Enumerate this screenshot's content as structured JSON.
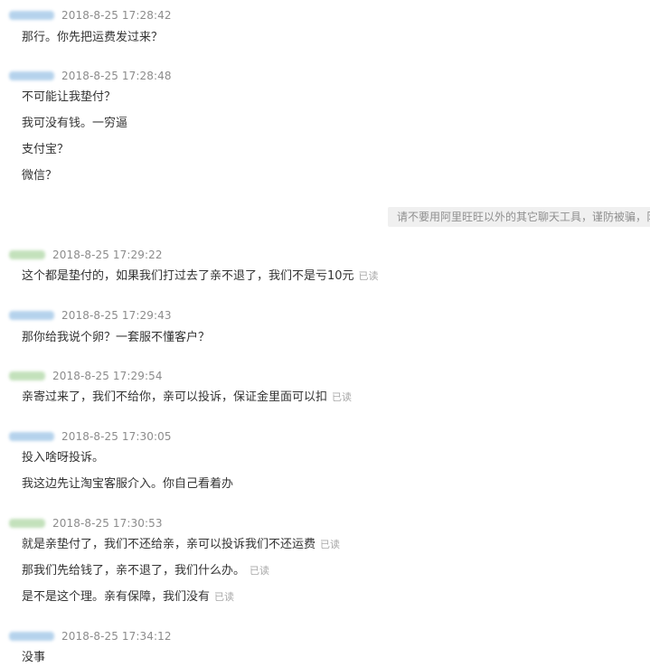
{
  "colors": {
    "customer_name_blur": "#a9cbe9",
    "seller_name_blur": "#b9dcb0",
    "timestamp": "#8c8c8c",
    "message_text": "#333333",
    "read_receipt": "#a9a9a9",
    "notice_bg": "#f0f0f0"
  },
  "notice": {
    "text": "请不要用阿里旺旺以外的其它聊天工具，谨防被骗，阝"
  },
  "groups": [
    {
      "sender": "customer",
      "time": "2018-8-25 17:28:42",
      "messages": [
        {
          "text": "那行。你先把运费发过来？",
          "read": ""
        }
      ]
    },
    {
      "sender": "customer",
      "time": "2018-8-25 17:28:48",
      "messages": [
        {
          "text": "不可能让我垫付？",
          "read": ""
        },
        {
          "text": "我可没有钱。一穷逼",
          "read": ""
        },
        {
          "text": "支付宝？",
          "read": ""
        },
        {
          "text": "微信？",
          "read": ""
        }
      ]
    },
    {
      "sender": "seller",
      "time": "2018-8-25 17:29:22",
      "messages": [
        {
          "text": "这个都是垫付的，如果我们打过去了亲不退了，我们不是亏10元",
          "read": "已读"
        }
      ]
    },
    {
      "sender": "customer",
      "time": "2018-8-25 17:29:43",
      "messages": [
        {
          "text": "那你给我说个卵？一套服不懂客户？",
          "read": ""
        }
      ]
    },
    {
      "sender": "seller",
      "time": "2018-8-25 17:29:54",
      "messages": [
        {
          "text": "亲寄过来了，我们不给你，亲可以投诉，保证金里面可以扣",
          "read": "已读"
        }
      ]
    },
    {
      "sender": "customer",
      "time": "2018-8-25 17:30:05",
      "messages": [
        {
          "text": "投入啥呀投诉。",
          "read": ""
        },
        {
          "text": "我这边先让淘宝客服介入。你自己看着办",
          "read": ""
        }
      ]
    },
    {
      "sender": "seller",
      "time": "2018-8-25 17:30:53",
      "messages": [
        {
          "text": "就是亲垫付了，我们不还给亲，亲可以投诉我们不还运费",
          "read": "已读"
        },
        {
          "text": "那我们先给钱了，亲不退了，我们什么办。",
          "read": "已读"
        },
        {
          "text": "是不是这个理。亲有保障，我们没有",
          "read": "已读"
        }
      ]
    },
    {
      "sender": "customer",
      "time": "2018-8-25 17:34:12",
      "messages": [
        {
          "text": "没事",
          "read": ""
        }
      ]
    }
  ]
}
